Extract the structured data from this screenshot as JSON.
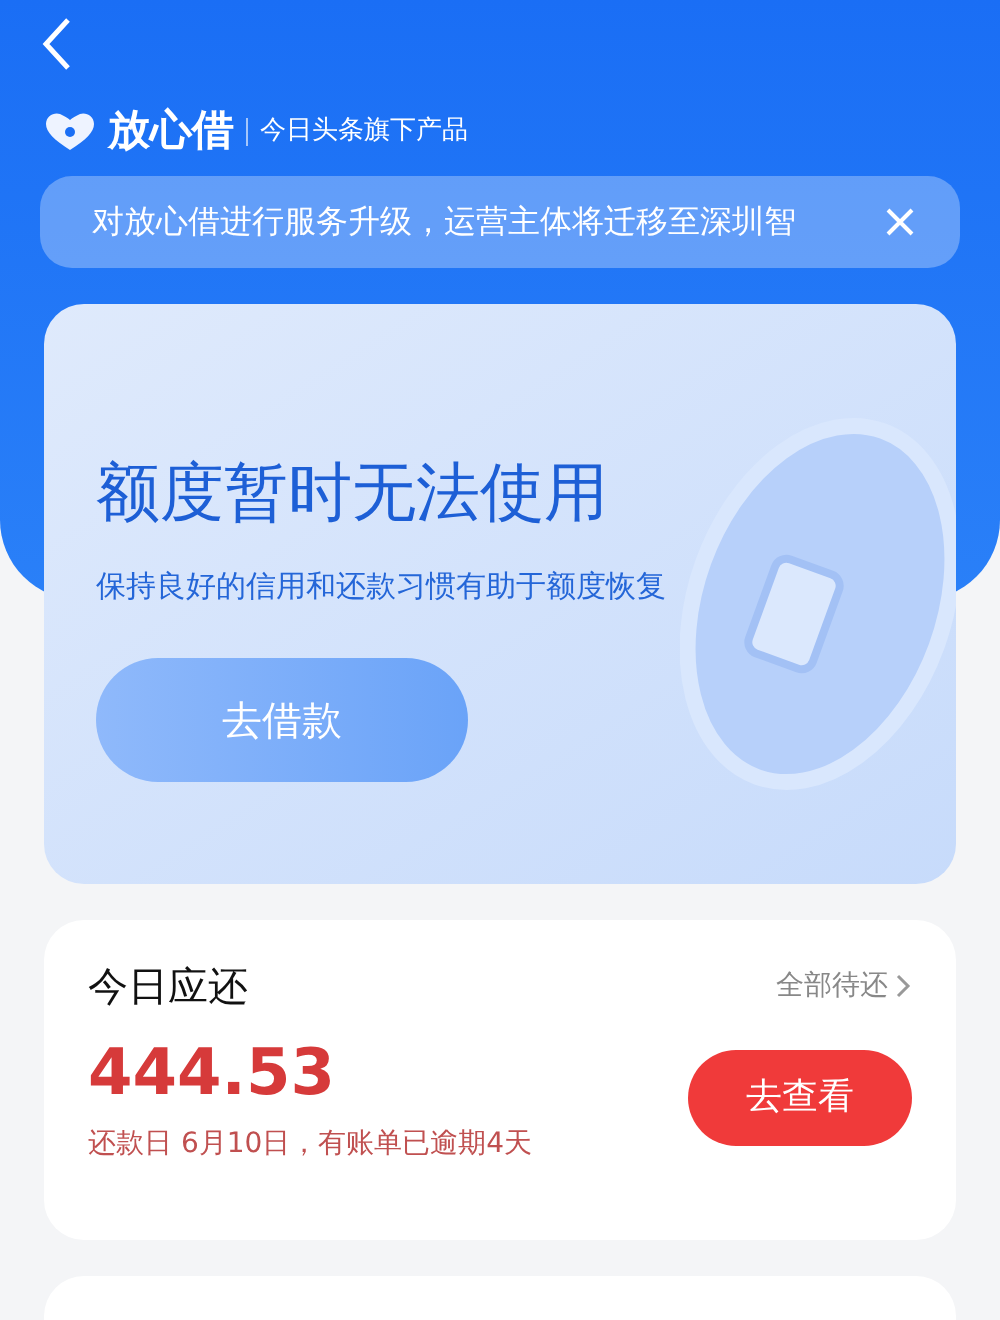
{
  "brand": {
    "name": "放心借",
    "tagline": "今日头条旗下产品"
  },
  "notice": {
    "text": "对放心借进行服务升级，运营主体将迁移至深圳智"
  },
  "hero": {
    "title": "额度暂时无法使用",
    "subtitle": "保持良好的信用和还款习惯有助于额度恢复",
    "button": "去借款"
  },
  "repayment": {
    "title": "今日应还",
    "link": "全部待还",
    "amount": "444.53",
    "note": "还款日 6月10日，有账单已逾期4天",
    "button": "去查看"
  }
}
